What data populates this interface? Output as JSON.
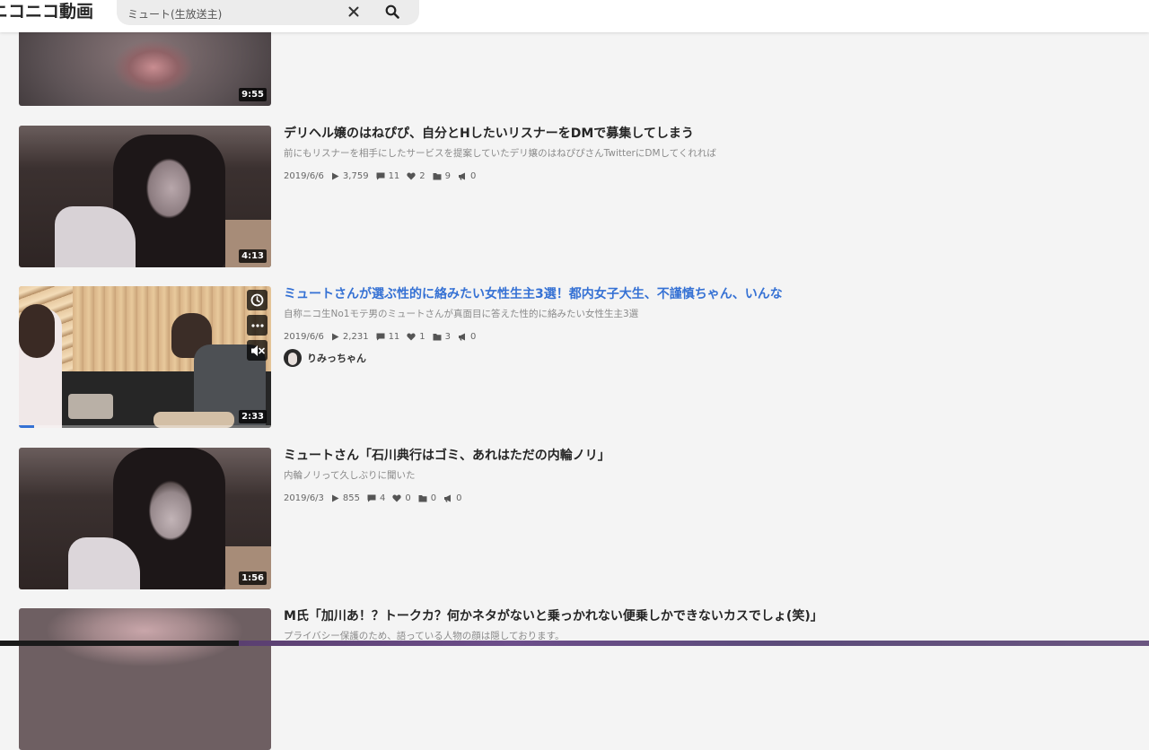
{
  "header": {
    "logo": "ニコニコ動画",
    "search_value": "ミュート(生放送主)"
  },
  "videos": [
    {
      "title": "",
      "duration": "9:55"
    },
    {
      "title": "デリヘル嬢のはねぴぴ、自分とHしたいリスナーをDMで募集してしまう",
      "description": "前にもリスナーを相手にしたサービスを提案していたデリ嬢のはねぴぴさんTwitterにDMしてくれれば",
      "date": "2019/6/6",
      "views": "3,759",
      "comments": "11",
      "likes": "2",
      "mylists": "9",
      "ads": "0",
      "duration": "4:13"
    },
    {
      "title": "ミュートさんが選ぶ性的に絡みたい女性生主3選！都内女子大生、不謹慎ちゃん、いんな",
      "description": "自称ニコ生No1モテ男のミュートさんが真面目に答えた性的に絡みたい女性生主3選",
      "date": "2019/6/6",
      "views": "2,231",
      "comments": "11",
      "likes": "1",
      "mylists": "3",
      "ads": "0",
      "duration": "2:33",
      "owner": "りみっちゃん",
      "progress": 0.06
    },
    {
      "title": "ミュートさん「石川典行はゴミ、あれはただの内輪ノリ」",
      "description": "内輪ノリって久しぶりに聞いた",
      "date": "2019/6/3",
      "views": "855",
      "comments": "4",
      "likes": "0",
      "mylists": "0",
      "ads": "0",
      "duration": "1:56"
    },
    {
      "title": "M氏「加川あ！？トークカ？何かネタがないと乗っかれない便乗しかできないカスでしょ(笑)」",
      "description": "プライバシー保護のため、語っている人物の顔は隠しております。"
    }
  ],
  "colors": {
    "accent": "#3571d4",
    "background": "#f4f4f4"
  },
  "icons": {
    "clear": "close-icon",
    "search": "search-icon",
    "watch_later": "clock-icon",
    "menu": "more-icon",
    "mute": "mute-icon",
    "views": "play-icon",
    "comments": "comment-icon",
    "likes": "heart-icon",
    "mylists": "folder-icon",
    "ads": "megaphone-icon"
  }
}
